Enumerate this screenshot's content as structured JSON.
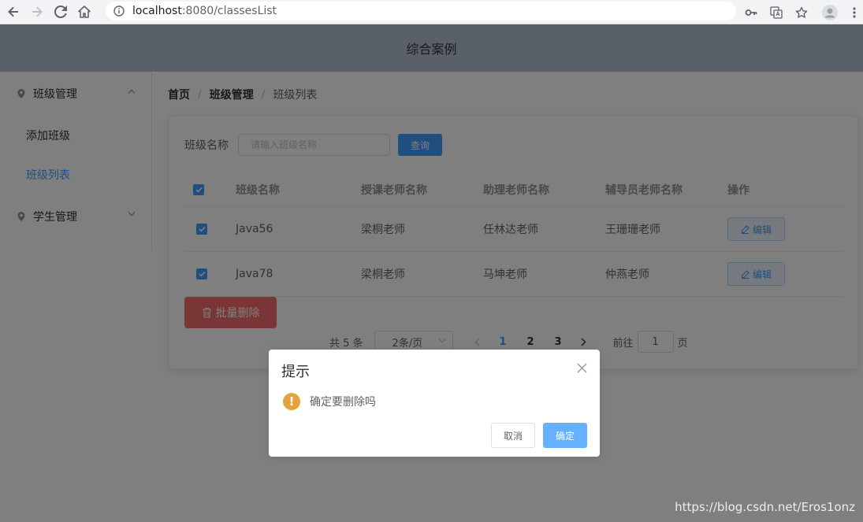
{
  "browser": {
    "url_host": "localhost",
    "url_path": ":8080/classesList"
  },
  "header": {
    "title": "综合案例"
  },
  "sidebar": {
    "groups": [
      {
        "label": "班级管理",
        "expanded": true,
        "items": [
          {
            "label": "添加班级",
            "active": false
          },
          {
            "label": "班级列表",
            "active": true
          }
        ]
      },
      {
        "label": "学生管理",
        "expanded": false,
        "items": []
      }
    ]
  },
  "breadcrumb": [
    "首页",
    "班级管理",
    "班级列表"
  ],
  "search": {
    "label": "班级名称",
    "placeholder": "请输入班级名称",
    "button": "查询"
  },
  "table": {
    "columns": [
      "班级名称",
      "授课老师名称",
      "助理老师名称",
      "辅导员老师名称",
      "操作"
    ],
    "rows": [
      {
        "checked": true,
        "name": "Java56",
        "teacher": "梁桐老师",
        "assistant": "任林达老师",
        "counselor": "王珊珊老师",
        "action": "编辑"
      },
      {
        "checked": true,
        "name": "Java78",
        "teacher": "梁桐老师",
        "assistant": "马坤老师",
        "counselor": "仲燕老师",
        "action": "编辑"
      }
    ]
  },
  "batch_delete": "批量删除",
  "pagination": {
    "total": "共 5 条",
    "page_size": "2条/页",
    "pages": [
      "1",
      "2",
      "3"
    ],
    "current": "1",
    "goto_prefix": "前往",
    "goto_value": "1",
    "goto_suffix": "页"
  },
  "dialog": {
    "title": "提示",
    "message": "确定要删除吗",
    "cancel": "取消",
    "confirm": "确定"
  },
  "watermark": "https://blog.csdn.net/Eros1onz",
  "colors": {
    "primary": "#409eff",
    "danger": "#f56c6c",
    "warning": "#e6a23c",
    "header_bg": "#b3c0d1"
  }
}
